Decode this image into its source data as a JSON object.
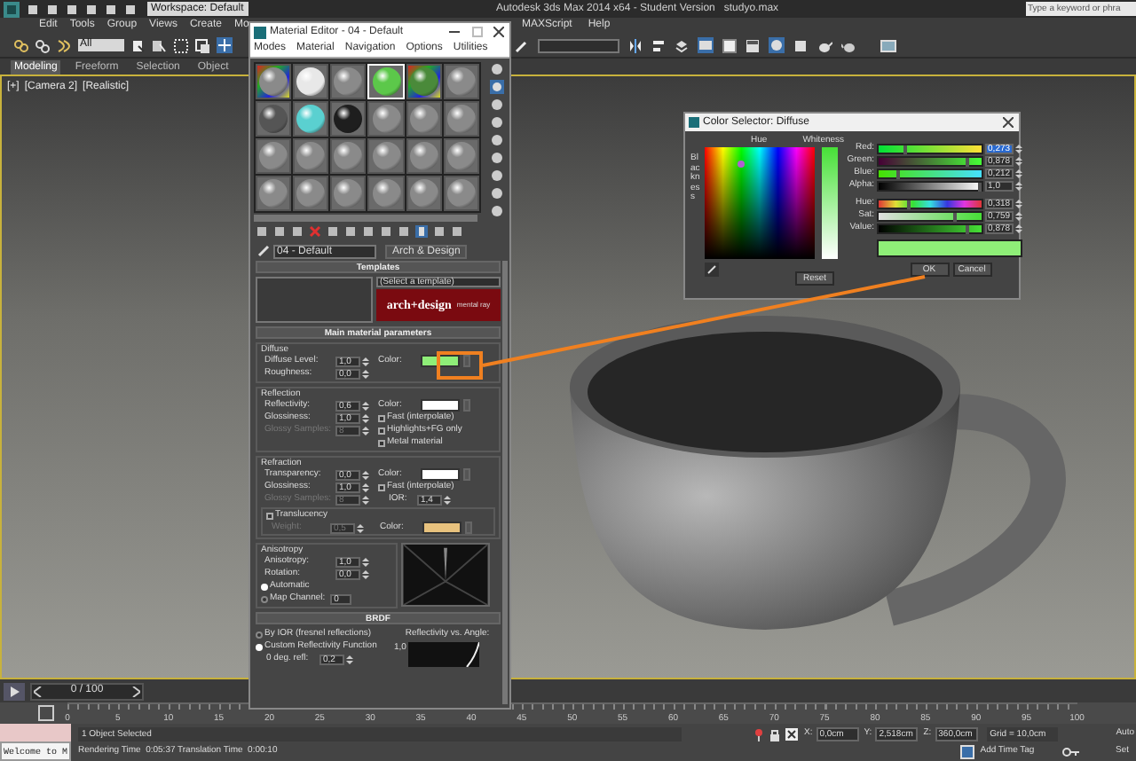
{
  "app": {
    "title": "Autodesk 3ds Max 2014 x64 - Student Version   studyo.max",
    "workspace": "Workspace: Default",
    "search": {
      "placeholder": "Type a keyword or phra"
    }
  },
  "menu": [
    "Edit",
    "Tools",
    "Group",
    "Views",
    "Create",
    "Mo",
    "MAXScript",
    "Help"
  ],
  "toolbar": {
    "selection_filter": "All"
  },
  "ribbon_tabs": [
    {
      "label": "Modeling",
      "selected": true
    },
    {
      "label": "Freeform",
      "selected": false
    },
    {
      "label": "Selection",
      "selected": false
    },
    {
      "label": "Object",
      "selected": false
    }
  ],
  "viewport": {
    "labels": [
      "[+]",
      "[Camera 2]",
      "[Realistic]"
    ]
  },
  "material_editor": {
    "title": "Material Editor - 04 - Default",
    "menu": [
      "Modes",
      "Material",
      "Navigation",
      "Options",
      "Utilities"
    ],
    "slots": [
      {
        "kind": "map",
        "color": "#8a8a8a",
        "selected": false
      },
      {
        "kind": "plain",
        "color": "#e8e8e8",
        "selected": false
      },
      {
        "kind": "plain",
        "color": "#8a8a8a",
        "selected": false
      },
      {
        "kind": "plain",
        "color": "#5cc84a",
        "selected": true
      },
      {
        "kind": "map",
        "color": "#4a8a3a",
        "selected": false
      },
      {
        "kind": "plain",
        "color": "#8a8a8a",
        "selected": false
      },
      {
        "kind": "plain",
        "color": "#555555",
        "selected": false
      },
      {
        "kind": "plain",
        "color": "#5ad0d0",
        "selected": false
      },
      {
        "kind": "plain",
        "color": "#1e1e1e",
        "selected": false
      },
      {
        "kind": "plain",
        "color": "#8a8a8a",
        "selected": false
      },
      {
        "kind": "plain",
        "color": "#8a8a8a",
        "selected": false
      },
      {
        "kind": "plain",
        "color": "#8a8a8a",
        "selected": false
      },
      {
        "kind": "plain",
        "color": "#8a8a8a",
        "selected": false
      },
      {
        "kind": "plain",
        "color": "#8a8a8a",
        "selected": false
      },
      {
        "kind": "plain",
        "color": "#8a8a8a",
        "selected": false
      },
      {
        "kind": "plain",
        "color": "#8a8a8a",
        "selected": false
      },
      {
        "kind": "plain",
        "color": "#8a8a8a",
        "selected": false
      },
      {
        "kind": "plain",
        "color": "#8a8a8a",
        "selected": false
      },
      {
        "kind": "plain",
        "color": "#8a8a8a",
        "selected": false
      },
      {
        "kind": "plain",
        "color": "#8a8a8a",
        "selected": false
      },
      {
        "kind": "plain",
        "color": "#8a8a8a",
        "selected": false
      },
      {
        "kind": "plain",
        "color": "#8a8a8a",
        "selected": false
      },
      {
        "kind": "plain",
        "color": "#8a8a8a",
        "selected": false
      },
      {
        "kind": "plain",
        "color": "#8a8a8a",
        "selected": false
      }
    ],
    "material_name": "04 - Default",
    "material_type": "Arch & Design",
    "templates": {
      "title": "Templates",
      "dropdown": "(Select a template)",
      "banner": "arch+design",
      "banner_sub": "mental ray"
    },
    "main": {
      "title": "Main material parameters",
      "groups": [
        {
          "kind": "standard",
          "title": "Diffuse",
          "rows": [
            {
              "label": "Diffuse Level:",
              "value": "1,0",
              "disabled": false
            },
            {
              "label": "Roughness:",
              "value": "0,0",
              "disabled": false
            }
          ],
          "right": [
            {
              "kind": "color",
              "label": "Color:",
              "color": "#8fee78"
            }
          ]
        },
        {
          "kind": "standard",
          "title": "Reflection",
          "rows": [
            {
              "label": "Reflectivity:",
              "value": "0,6",
              "disabled": false
            },
            {
              "label": "Glossiness:",
              "value": "1,0",
              "disabled": false
            },
            {
              "label": "Glossy Samples:",
              "value": "8",
              "disabled": true
            }
          ],
          "right": [
            {
              "kind": "color",
              "label": "Color:",
              "color": "#ffffff"
            },
            {
              "kind": "check",
              "label": "Fast (interpolate)",
              "checked": false
            },
            {
              "kind": "check",
              "label": "Highlights+FG only",
              "checked": false
            },
            {
              "kind": "check",
              "label": "Metal material",
              "checked": false
            }
          ]
        },
        {
          "kind": "standard",
          "title": "Refraction",
          "rows": [
            {
              "label": "Transparency:",
              "value": "0,0",
              "disabled": false
            },
            {
              "label": "Glossiness:",
              "value": "1,0",
              "disabled": false
            },
            {
              "label": "Glossy Samples:",
              "value": "8",
              "disabled": true
            }
          ],
          "right": [
            {
              "kind": "color",
              "label": "Color:",
              "color": "#ffffff"
            },
            {
              "kind": "check",
              "label": "Fast (interpolate)",
              "checked": false
            },
            {
              "kind": "spin",
              "label": "IOR:",
              "value": "1,4"
            }
          ],
          "translucency": {
            "label": "Translucency",
            "checked": false,
            "weight_label": "Weight:",
            "weight": "0,5",
            "color_label": "Color:",
            "color": "#e8c27e"
          }
        },
        {
          "kind": "anisotropy",
          "title": "Anisotropy",
          "rows": [
            {
              "label": "Anisotropy:",
              "value": "1,0",
              "disabled": false
            },
            {
              "label": "Rotation:",
              "value": "0,0",
              "disabled": false
            }
          ],
          "radios": [
            {
              "label": "Automatic",
              "selected": true
            },
            {
              "label": "Map Channel:",
              "selected": false,
              "value": "0"
            }
          ]
        }
      ]
    },
    "brdf": {
      "title": "BRDF",
      "radios": [
        {
          "label": "By IOR (fresnel reflections)",
          "selected": false
        },
        {
          "label": "Custom Reflectivity Function",
          "selected": true
        }
      ],
      "row": {
        "label": "0 deg. refl:",
        "value": "0,2"
      },
      "graph_label": "Reflectivity vs. Angle:",
      "graph_value": "1,0"
    }
  },
  "color_selector": {
    "title": "Color Selector: Diffuse",
    "hue_label": "Hue",
    "whiteness_label": "Whiteness",
    "blackness_label": "Blackness",
    "channels": [
      {
        "kind": "red",
        "label": "Red:",
        "value": "0,273",
        "level": 0.29,
        "focused": true
      },
      {
        "kind": "green",
        "label": "Green:",
        "value": "0,878",
        "level": 0.88,
        "focused": false
      },
      {
        "kind": "blue",
        "label": "Blue:",
        "value": "0,212",
        "level": 0.21,
        "focused": false
      },
      {
        "kind": "alpha",
        "label": "Alpha:",
        "value": "1,0",
        "level": 1.0,
        "focused": false
      },
      {
        "kind": "hue",
        "label": "Hue:",
        "value": "0,318",
        "level": 0.32,
        "focused": false
      },
      {
        "kind": "sat",
        "label": "Sat:",
        "value": "0,759",
        "level": 0.76,
        "focused": false
      },
      {
        "kind": "value",
        "label": "Value:",
        "value": "0,878",
        "level": 0.88,
        "focused": false
      }
    ],
    "swatch": {
      "color": "#8fee78"
    },
    "buttons": [
      "Reset",
      "OK",
      "Cancel"
    ]
  },
  "timeline": {
    "position": "0 / 100",
    "ticks": [
      "0",
      "5",
      "10",
      "15",
      "20",
      "25",
      "30",
      "35",
      "40",
      "45",
      "50",
      "55",
      "60",
      "65",
      "70",
      "75",
      "80",
      "85",
      "90",
      "95",
      "100"
    ]
  },
  "status_bar": {
    "welcome": "Welcome to M",
    "selection": "1 Object Selected",
    "rendering_time": "Rendering Time  0:05:37",
    "translation_time": "Translation Time  0:00:10",
    "coords": [
      {
        "label": "X:",
        "value": "0,0cm"
      },
      {
        "label": "Y:",
        "value": "2,518cm"
      },
      {
        "label": "Z:",
        "value": "360,0cm"
      }
    ],
    "grid": "Grid = 10,0cm",
    "time_tag": "Add Time Tag",
    "auto": "Auto",
    "set": "Set"
  }
}
